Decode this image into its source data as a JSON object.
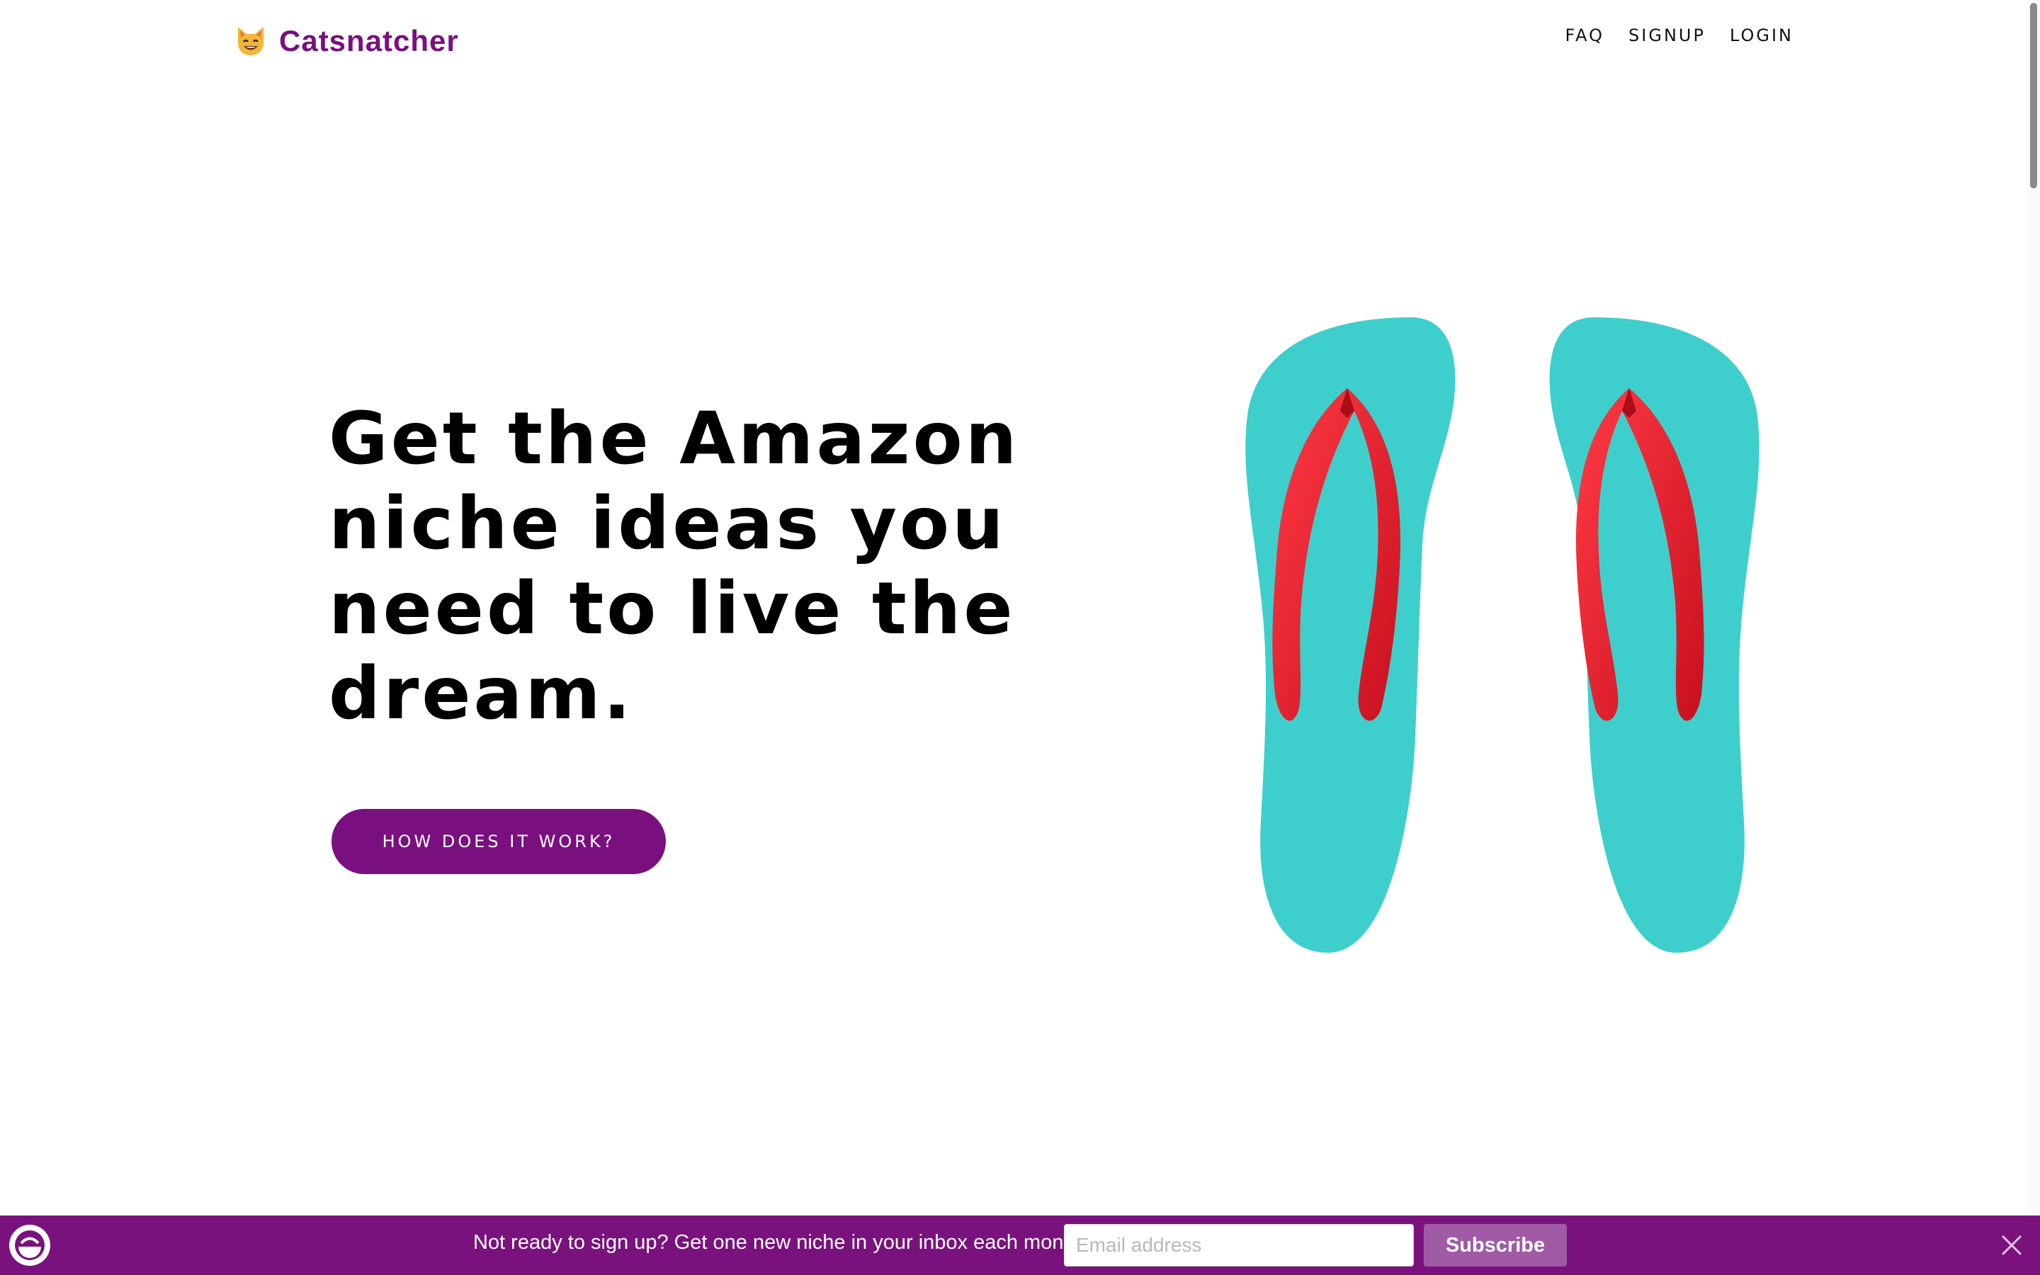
{
  "header": {
    "brand": "Catsnatcher",
    "nav": [
      {
        "label": "FAQ"
      },
      {
        "label": "SIGNUP"
      },
      {
        "label": "LOGIN"
      }
    ]
  },
  "hero": {
    "title": "Get the Amazon niche ideas you need to live the dream.",
    "cta_label": "HOW DOES IT WORK?"
  },
  "signup_bar": {
    "text": "Not ready to sign up? Get one new niche in your inbox each month",
    "email_placeholder": "Email address",
    "email_value": "",
    "subscribe_label": "Subscribe"
  },
  "colors": {
    "brand_purple": "#7a0f7f",
    "sole_teal": "#3ecfcc",
    "strap_red": "#e8202e",
    "subscribe_bg": "#a05aa6"
  },
  "icons": {
    "logo": "cat-face-icon",
    "bar_logo": "newsletter-logo-icon",
    "close": "close-icon"
  }
}
